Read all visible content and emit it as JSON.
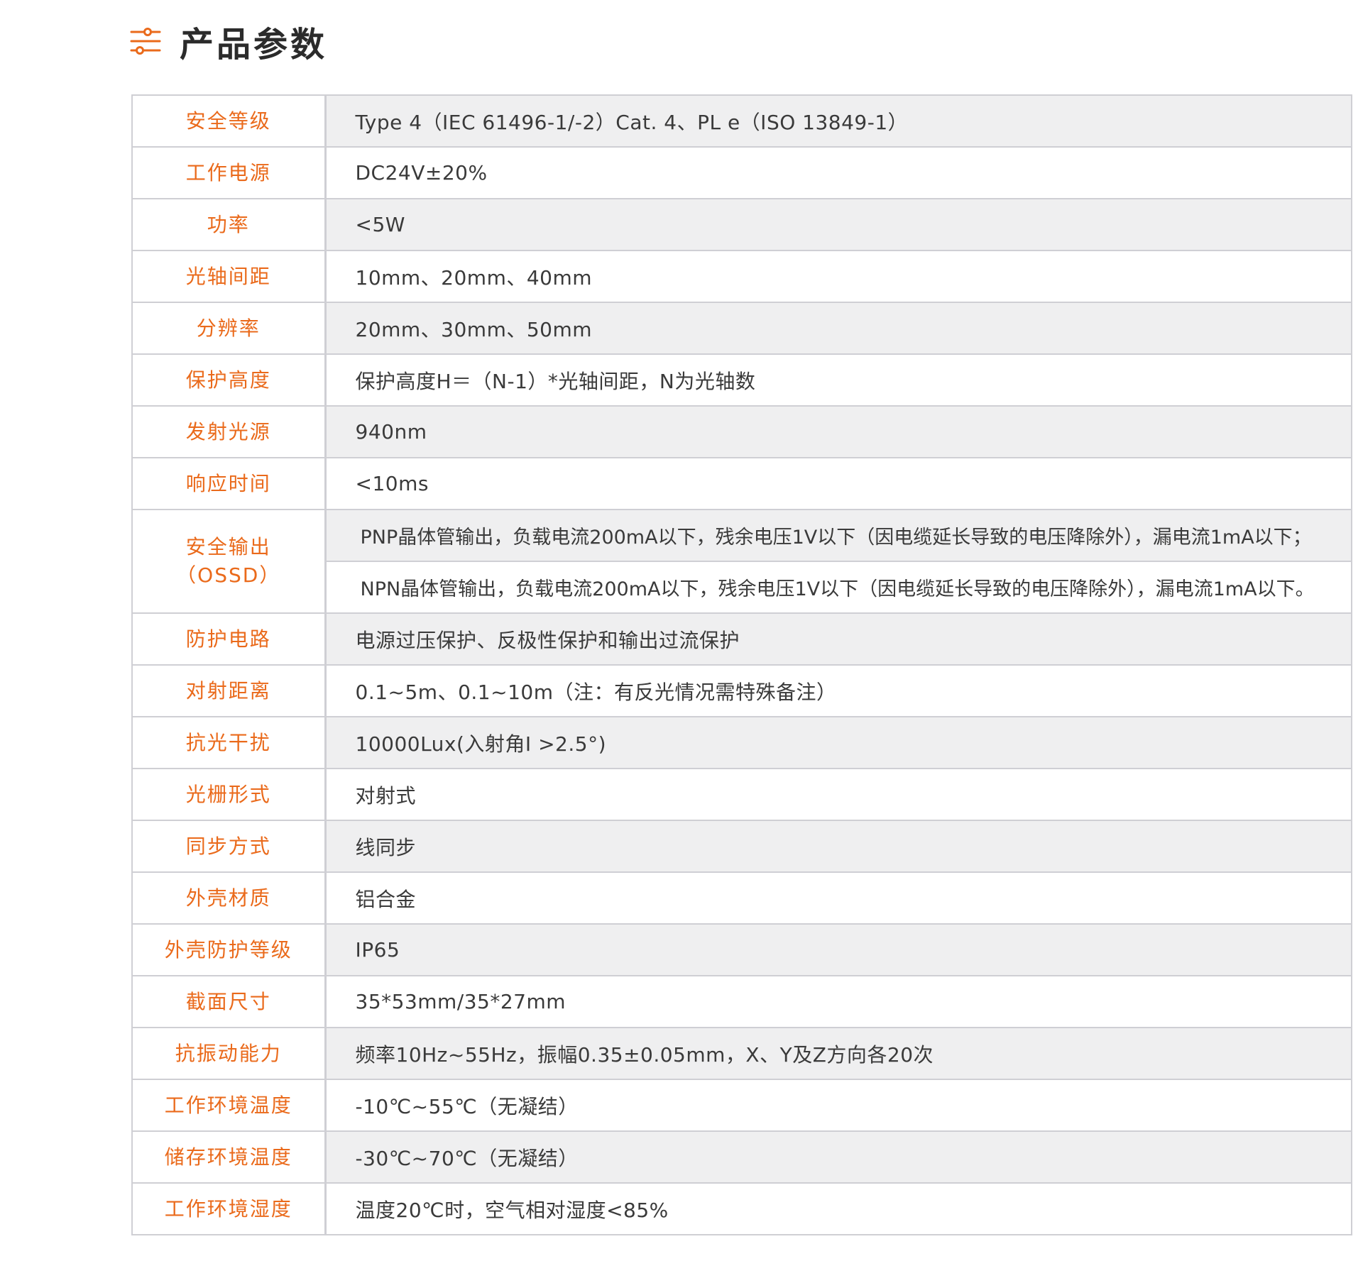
{
  "header": {
    "icon": "sliders-icon",
    "title": "产品参数"
  },
  "colors": {
    "accent": "#ea6a1b",
    "stripe": "#efeff0",
    "border": "#cfcfd4"
  },
  "specs": [
    {
      "label": "安全等级",
      "value": "Type 4（IEC 61496-1/-2）Cat. 4、PL e（ISO 13849-1）"
    },
    {
      "label": "工作电源",
      "value": "DC24V±20%"
    },
    {
      "label": "功率",
      "value": "<5W"
    },
    {
      "label": "光轴间距",
      "value": "10mm、20mm、40mm"
    },
    {
      "label": "分辨率",
      "value": "20mm、30mm、50mm"
    },
    {
      "label": "保护高度",
      "value": "保护高度H＝（N-1）*光轴间距，N为光轴数"
    },
    {
      "label": "发射光源",
      "value": "940nm"
    },
    {
      "label": "响应时间",
      "value": "<10ms"
    },
    {
      "label": "安全输出",
      "label2": "（OSSD）",
      "values": [
        "PNP晶体管输出，负载电流200mA以下，残余电压1V以下（因电缆延长导致的电压降除外），漏电流1mA以下；",
        "NPN晶体管输出，负载电流200mA以下，残余电压1V以下（因电缆延长导致的电压降除外），漏电流1mA以下。"
      ]
    },
    {
      "label": "防护电路",
      "value": "电源过压保护、反极性保护和输出过流保护"
    },
    {
      "label": "对射距离",
      "value": "0.1~5m、0.1~10m（注：有反光情况需特殊备注）"
    },
    {
      "label": "抗光干扰",
      "value": "10000Lux(入射角I >2.5°)"
    },
    {
      "label": "光栅形式",
      "value": "对射式"
    },
    {
      "label": "同步方式",
      "value": "线同步"
    },
    {
      "label": "外壳材质",
      "value": "铝合金"
    },
    {
      "label": "外壳防护等级",
      "value": "IP65"
    },
    {
      "label": "截面尺寸",
      "value": "35*53mm/35*27mm"
    },
    {
      "label": "抗振动能力",
      "value": "频率10Hz~55Hz，振幅0.35±0.05mm，X、Y及Z方向各20次"
    },
    {
      "label": "工作环境温度",
      "value": "-10℃~55℃（无凝结）"
    },
    {
      "label": "储存环境温度",
      "value": "-30℃~70℃（无凝结）"
    },
    {
      "label": "工作环境湿度",
      "value": "温度20℃时，空气相对湿度<85%"
    }
  ]
}
